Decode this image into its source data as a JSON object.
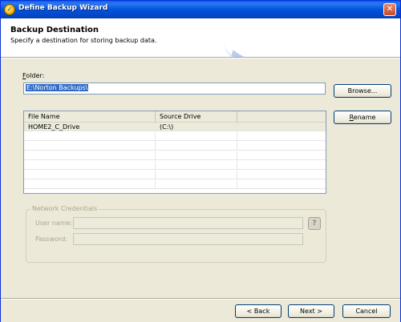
{
  "window": {
    "title": "Define Backup Wizard",
    "close_glyph": "✕"
  },
  "header": {
    "title": "Backup Destination",
    "subtitle": "Specify a destination for storing backup data."
  },
  "folder": {
    "label_hotkey": "F",
    "label_rest": "older:",
    "value": "E:\\Norton Backups\\",
    "browse_label": "Browse..."
  },
  "list": {
    "columns": [
      "File Name",
      "Source Drive"
    ],
    "rows": [
      {
        "file_name": "HOME2_C_Drive",
        "source_drive": "(C:\\)"
      }
    ],
    "rename_label": "Rename"
  },
  "credentials": {
    "group_title": "Network Credentials",
    "username_label": "User name:",
    "password_label": "Password:",
    "username_value": "",
    "password_value": "",
    "help_glyph": "?"
  },
  "footer": {
    "back_label": "< Back",
    "next_label": "Next >",
    "cancel_label": "Cancel"
  },
  "colors": {
    "titlebar": "#0453dc",
    "selection": "#316ac5",
    "dialog_bg": "#ece9d8"
  },
  "icons": {
    "app": "norton-app-icon",
    "close": "close-icon",
    "help": "help-icon"
  }
}
